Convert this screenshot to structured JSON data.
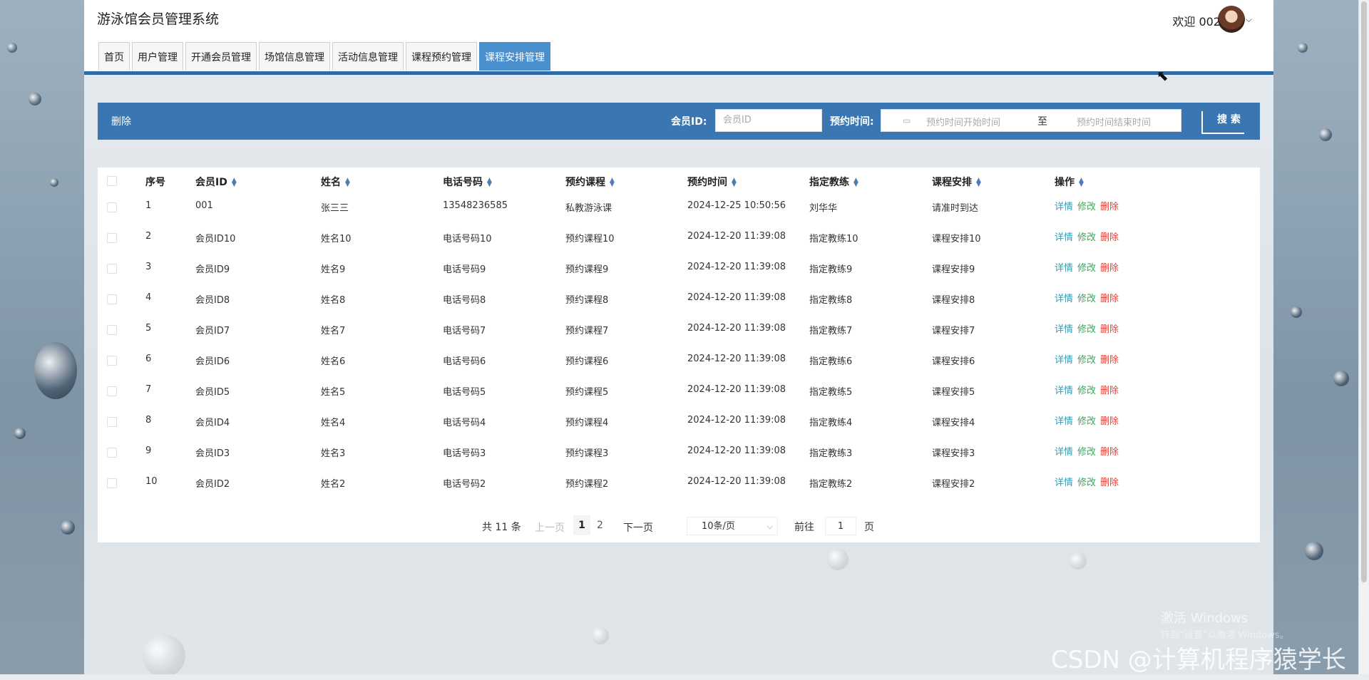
{
  "app": {
    "title": "游泳馆会员管理系统",
    "welcome": "欢迎 002"
  },
  "tabs": [
    {
      "label": "首页"
    },
    {
      "label": "用户管理"
    },
    {
      "label": "开通会员管理"
    },
    {
      "label": "场馆信息管理"
    },
    {
      "label": "活动信息管理"
    },
    {
      "label": "课程预约管理"
    },
    {
      "label": "课程安排管理",
      "active": true
    }
  ],
  "toolbar": {
    "delete_label": "删除",
    "member_id_label": "会员ID:",
    "member_id_placeholder": "会员ID",
    "time_label": "预约时间:",
    "start_placeholder": "预约时间开始时间",
    "range_sep": "至",
    "end_placeholder": "预约时间结束时间",
    "search_label": "搜 索"
  },
  "table": {
    "headers": {
      "index": "序号",
      "member_id": "会员ID",
      "name": "姓名",
      "phone": "电话号码",
      "course": "预约课程",
      "time": "预约时间",
      "coach": "指定教练",
      "schedule": "课程安排",
      "ops": "操作"
    },
    "rows": [
      {
        "index": "1",
        "member_id": "001",
        "name": "张三三",
        "phone": "13548236585",
        "course": "私教游泳课",
        "time": "2024-12-25 10:50:56",
        "coach": "刘华华",
        "schedule": "请准时到达"
      },
      {
        "index": "2",
        "member_id": "会员ID10",
        "name": "姓名10",
        "phone": "电话号码10",
        "course": "预约课程10",
        "time": "2024-12-20 11:39:08",
        "coach": "指定教练10",
        "schedule": "课程安排10"
      },
      {
        "index": "3",
        "member_id": "会员ID9",
        "name": "姓名9",
        "phone": "电话号码9",
        "course": "预约课程9",
        "time": "2024-12-20 11:39:08",
        "coach": "指定教练9",
        "schedule": "课程安排9"
      },
      {
        "index": "4",
        "member_id": "会员ID8",
        "name": "姓名8",
        "phone": "电话号码8",
        "course": "预约课程8",
        "time": "2024-12-20 11:39:08",
        "coach": "指定教练8",
        "schedule": "课程安排8"
      },
      {
        "index": "5",
        "member_id": "会员ID7",
        "name": "姓名7",
        "phone": "电话号码7",
        "course": "预约课程7",
        "time": "2024-12-20 11:39:08",
        "coach": "指定教练7",
        "schedule": "课程安排7"
      },
      {
        "index": "6",
        "member_id": "会员ID6",
        "name": "姓名6",
        "phone": "电话号码6",
        "course": "预约课程6",
        "time": "2024-12-20 11:39:08",
        "coach": "指定教练6",
        "schedule": "课程安排6"
      },
      {
        "index": "7",
        "member_id": "会员ID5",
        "name": "姓名5",
        "phone": "电话号码5",
        "course": "预约课程5",
        "time": "2024-12-20 11:39:08",
        "coach": "指定教练5",
        "schedule": "课程安排5"
      },
      {
        "index": "8",
        "member_id": "会员ID4",
        "name": "姓名4",
        "phone": "电话号码4",
        "course": "预约课程4",
        "time": "2024-12-20 11:39:08",
        "coach": "指定教练4",
        "schedule": "课程安排4"
      },
      {
        "index": "9",
        "member_id": "会员ID3",
        "name": "姓名3",
        "phone": "电话号码3",
        "course": "预约课程3",
        "time": "2024-12-20 11:39:08",
        "coach": "指定教练3",
        "schedule": "课程安排3"
      },
      {
        "index": "10",
        "member_id": "会员ID2",
        "name": "姓名2",
        "phone": "电话号码2",
        "course": "预约课程2",
        "time": "2024-12-20 11:39:08",
        "coach": "指定教练2",
        "schedule": "课程安排2"
      }
    ],
    "ops": {
      "detail": "详情",
      "edit": "修改",
      "remove": "删除"
    }
  },
  "pager": {
    "total": "共 11 条",
    "prev": "上一页",
    "page1": "1",
    "page2": "2",
    "next": "下一页",
    "page_size": "10条/页",
    "goto": "前往",
    "goto_value": "1",
    "page_suffix": "页"
  },
  "overlay": {
    "activate_windows": "激活 Windows",
    "activate_hint": "转到“设置”以激活 Windows。",
    "csdn": "CSDN @计算机程序猿学长"
  },
  "icons": {
    "calendar": "calendar-icon",
    "sort": "sort-icon",
    "chevron": "chevron-down-icon",
    "cursor": "mouse-cursor-icon"
  },
  "colors": {
    "accent": "#3a77b2",
    "tab_active": "#4a8fce",
    "detail": "#2a9fb6",
    "edit": "#3aa85a",
    "remove": "#e0443b"
  }
}
